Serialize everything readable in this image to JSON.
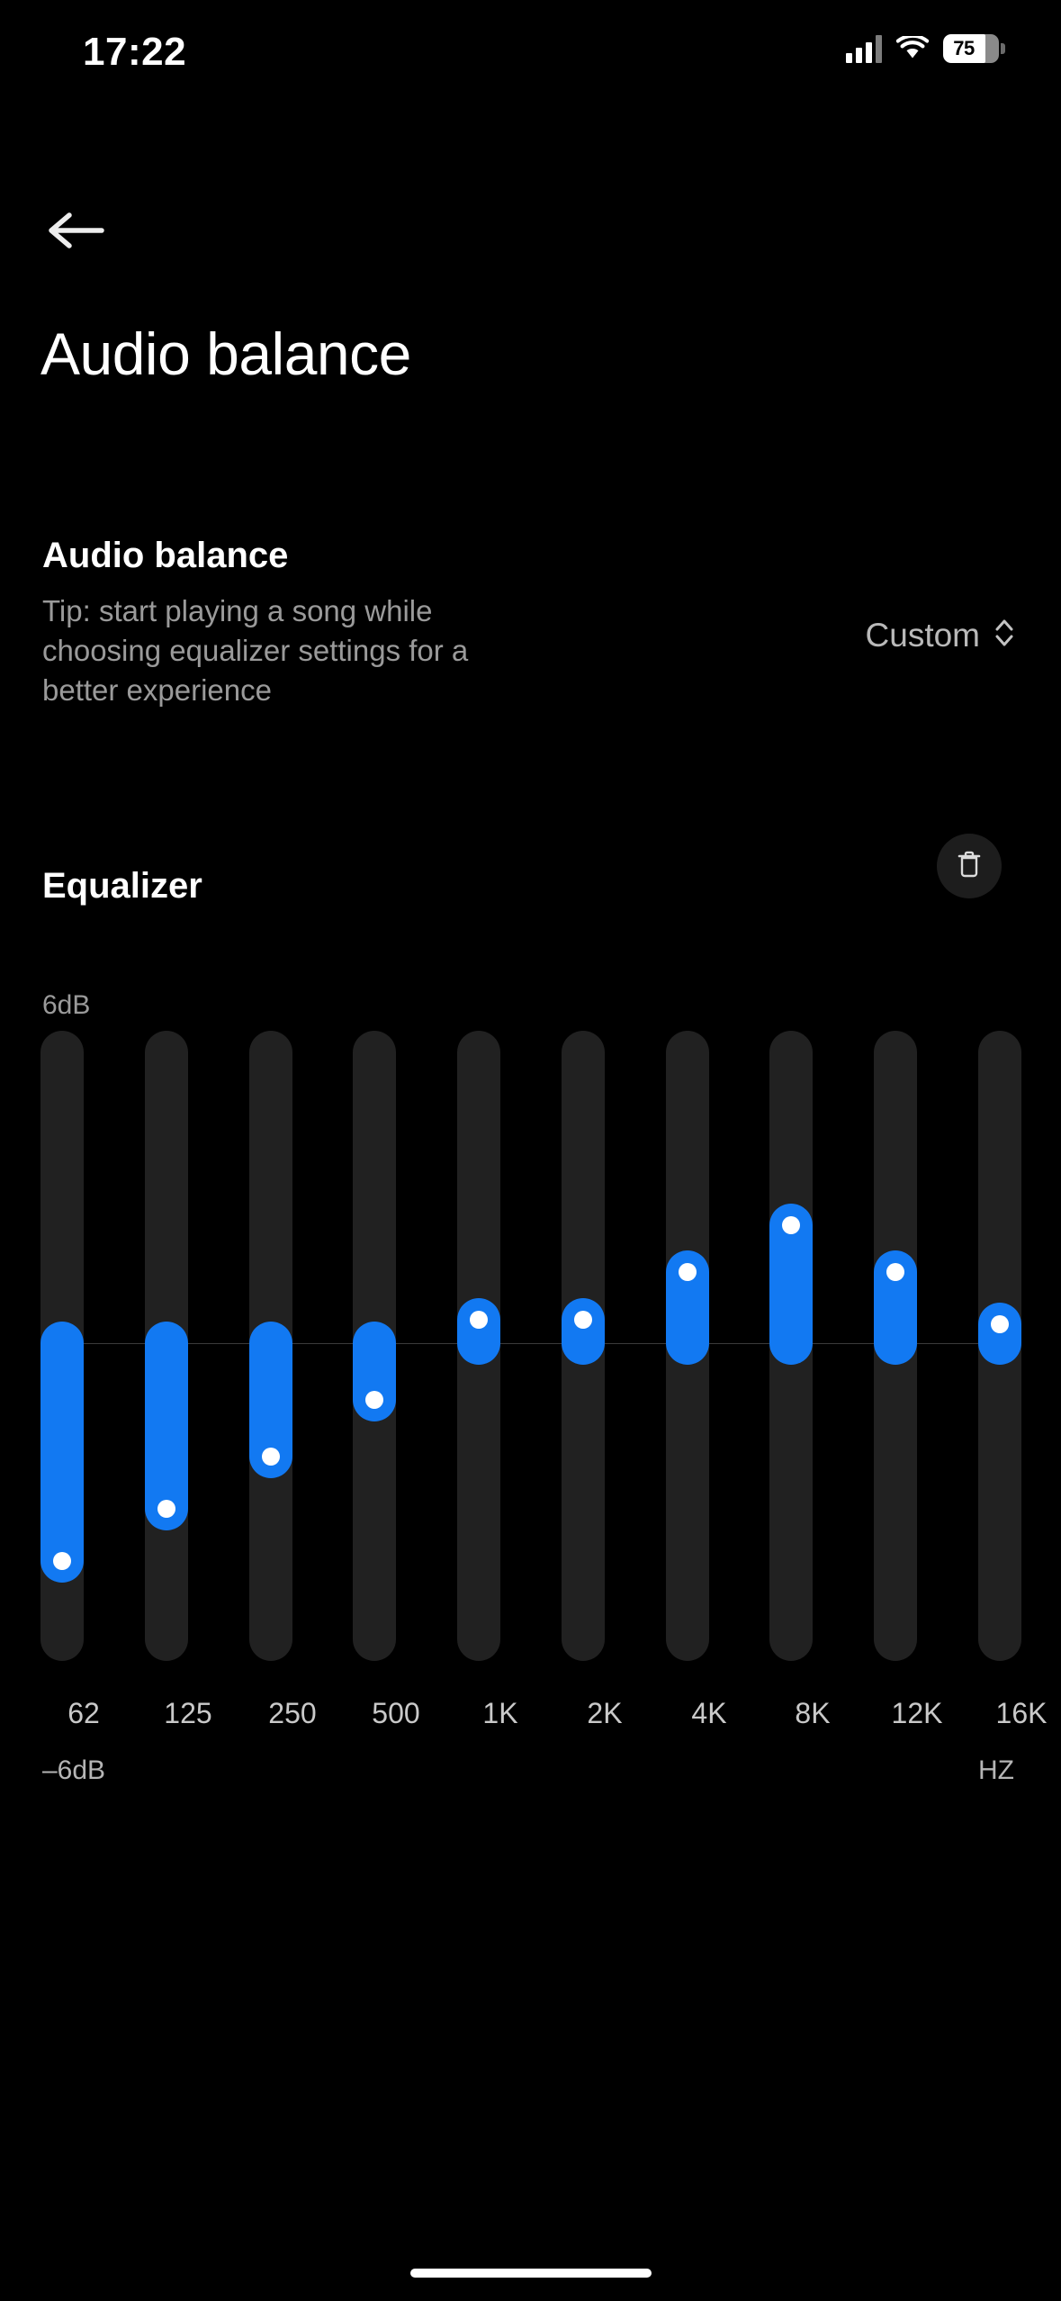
{
  "status_bar": {
    "time": "17:22",
    "battery_percent": "75",
    "battery_level": 75,
    "signal_icon": "cellular-signal-icon",
    "wifi_icon": "wifi-icon"
  },
  "nav": {
    "back_icon": "back-arrow-icon",
    "page_title": "Audio balance"
  },
  "audio_balance": {
    "title": "Audio balance",
    "tip": "Tip: start playing a song while choosing equalizer settings for a better experience",
    "selected_preset": "Custom",
    "stepper_icon": "chevron-up-down-icon"
  },
  "equalizer": {
    "title": "Equalizer",
    "reset_icon": "trash-icon",
    "top_label": "6dB",
    "bottom_label": "–6dB",
    "unit_label": "HZ",
    "accent_color": "#1279f2",
    "track_color": "#212121"
  },
  "chart_data": {
    "type": "bar",
    "title": "Equalizer",
    "xlabel": "HZ",
    "ylabel": "dB",
    "ylim": [
      -6,
      6
    ],
    "grid": false,
    "legend": null,
    "categories": [
      "62",
      "125",
      "250",
      "500",
      "1K",
      "2K",
      "4K",
      "8K",
      "12K",
      "16K"
    ],
    "values": [
      -4.6,
      -3.5,
      -2.4,
      -1.2,
      0.5,
      0.5,
      1.5,
      2.5,
      1.5,
      0.4
    ],
    "tick_labels_y": [
      "6dB",
      "–6dB"
    ],
    "annotations": [
      "0 dB reference line at center"
    ]
  },
  "home_indicator": "home-indicator"
}
